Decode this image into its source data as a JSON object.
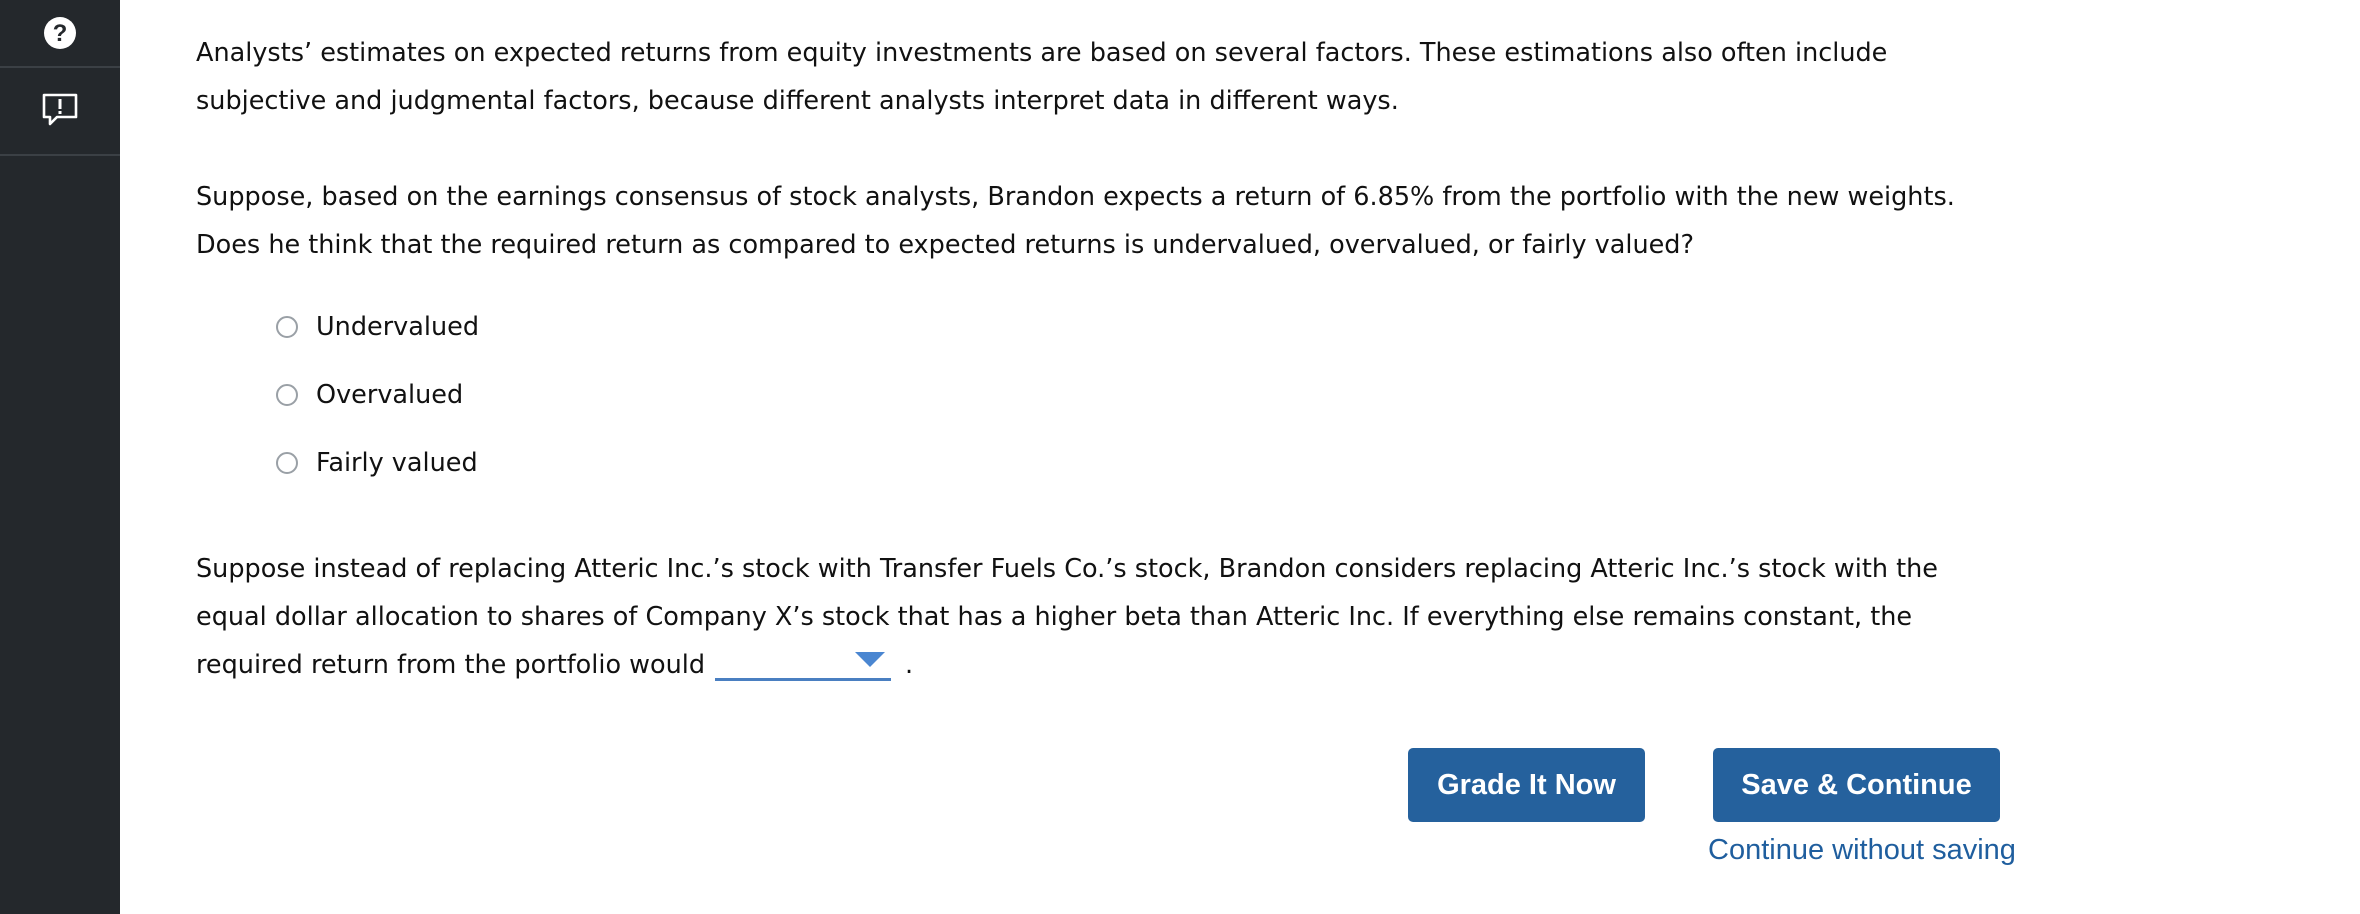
{
  "sidebar": {
    "help_icon": "question-circle-icon",
    "report_icon": "report-problem-icon"
  },
  "question": {
    "intro": "Analysts’ estimates on expected returns from equity investments are based on several factors. These estimations also often include subjective and judgmental factors, because different analysts interpret data in different ways.",
    "prompt": "Suppose, based on the earnings consensus of stock analysts, Brandon expects a return of 6.85% from the portfolio with the new weights. Does he think that the required return as compared to expected returns is undervalued, overvalued, or fairly valued?",
    "options": [
      {
        "label": "Undervalued"
      },
      {
        "label": "Overvalued"
      },
      {
        "label": "Fairly valued"
      }
    ],
    "fill_in_text": "Suppose instead of replacing Atteric Inc.’s stock with Transfer Fuels Co.’s stock, Brandon considers replacing Atteric Inc.’s stock with the equal dollar allocation to shares of Company X’s stock that has a higher beta than Atteric Inc. If everything else remains constant, the required return from the portfolio would",
    "dropdown_value": "",
    "trailing_period": "."
  },
  "actions": {
    "grade_label": "Grade It Now",
    "save_label": "Save & Continue",
    "continue_label": "Continue without saving"
  },
  "colors": {
    "sidebar_bg": "#24282c",
    "button_bg": "#25619d",
    "link": "#1f5e9e",
    "dropdown_accent": "#4a86d1"
  }
}
